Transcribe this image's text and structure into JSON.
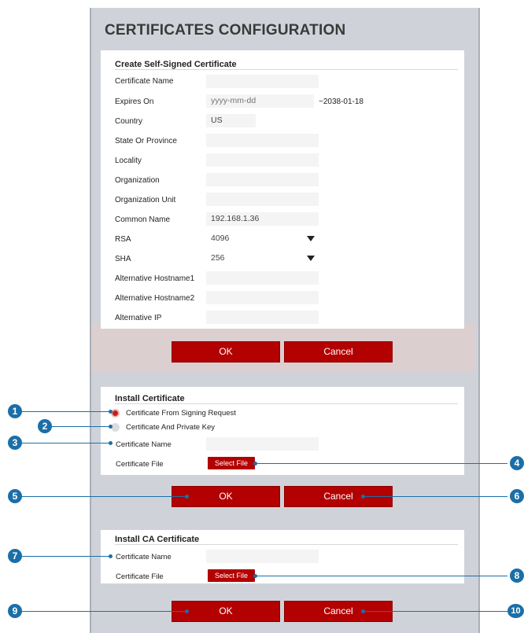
{
  "page_title": "CERTIFICATES CONFIGURATION",
  "self_signed": {
    "title": "Create Self-Signed Certificate",
    "fields": {
      "certificate_name": {
        "label": "Certificate Name",
        "value": ""
      },
      "expires_on": {
        "label": "Expires On",
        "value": "yyyy-mm-dd",
        "hint": "~2038-01-18"
      },
      "country": {
        "label": "Country",
        "value": "US"
      },
      "state": {
        "label": "State Or Province",
        "value": ""
      },
      "locality": {
        "label": "Locality",
        "value": ""
      },
      "organization": {
        "label": "Organization",
        "value": ""
      },
      "organization_unit": {
        "label": "Organization Unit",
        "value": ""
      },
      "common_name": {
        "label": "Common Name",
        "value": "192.168.1.36"
      },
      "rsa": {
        "label": "RSA",
        "value": "4096"
      },
      "sha": {
        "label": "SHA",
        "value": "256"
      },
      "alt_hostname1": {
        "label": "Alternative Hostname1",
        "value": ""
      },
      "alt_hostname2": {
        "label": "Alternative Hostname2",
        "value": ""
      },
      "alt_ip": {
        "label": "Alternative IP",
        "value": ""
      }
    },
    "ok_label": "OK",
    "cancel_label": "Cancel"
  },
  "install_cert": {
    "title": "Install Certificate",
    "radio_signing_request": "Certificate From Signing Request",
    "radio_private_key": "Certificate And Private Key",
    "selected_radio": "signing_request",
    "cert_name_label": "Certificate Name",
    "cert_file_label": "Certificate File",
    "select_file_label": "Select File",
    "ok_label": "OK",
    "cancel_label": "Cancel"
  },
  "install_ca": {
    "title": "Install CA Certificate",
    "cert_name_label": "Certificate Name",
    "cert_file_label": "Certificate File",
    "select_file_label": "Select File",
    "ok_label": "OK",
    "cancel_label": "Cancel"
  },
  "callouts": [
    "1",
    "2",
    "3",
    "4",
    "5",
    "6",
    "7",
    "8",
    "9",
    "10"
  ],
  "colors": {
    "accent_red": "#b30000",
    "callout_blue": "#1b6fa8",
    "panel_gray": "#cfd3d9"
  }
}
